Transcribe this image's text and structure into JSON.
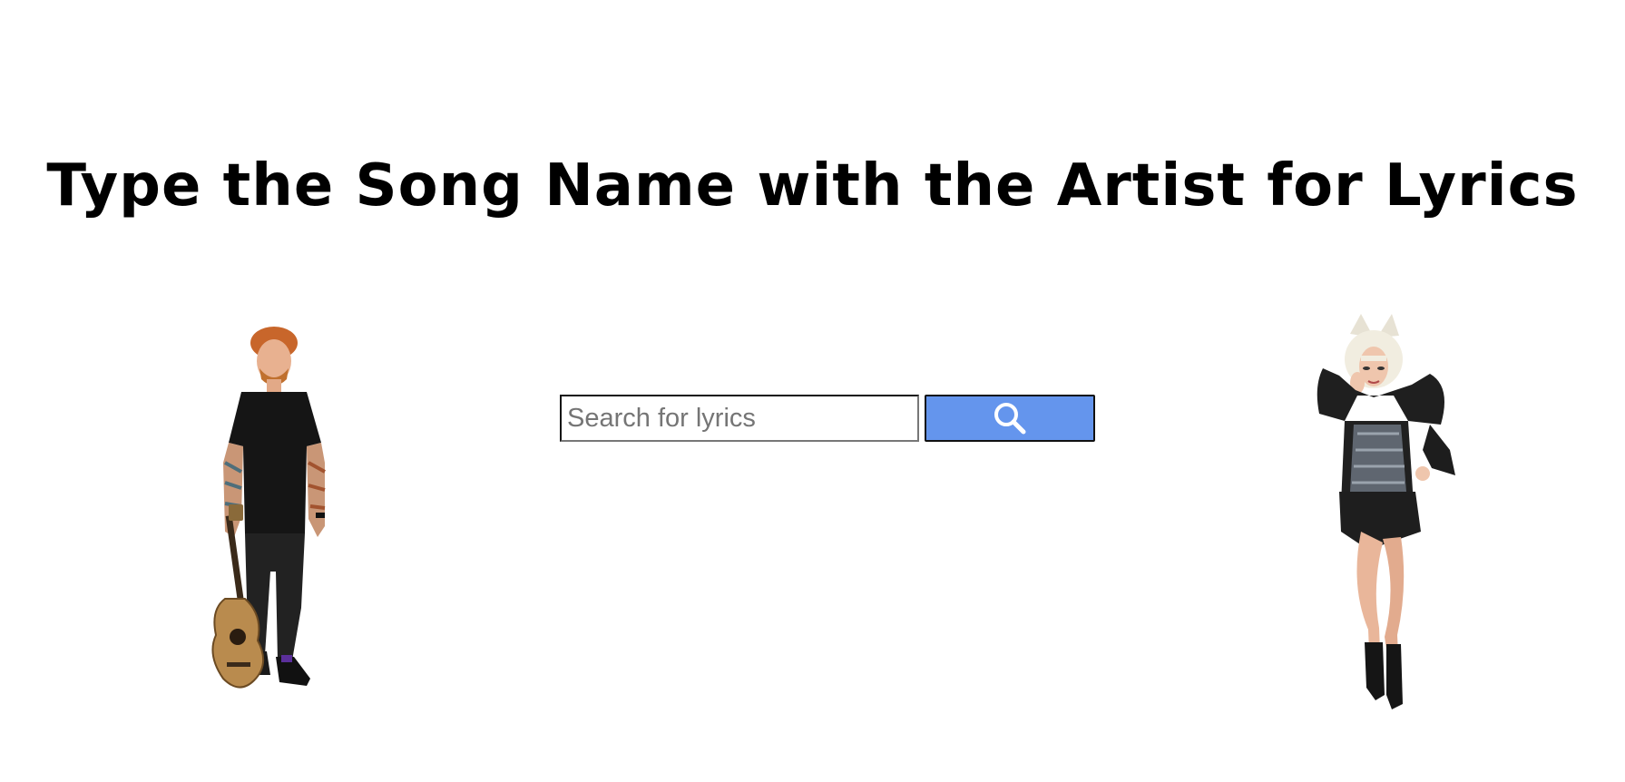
{
  "page": {
    "title": "Type the Song Name with the Artist for Lyrics"
  },
  "search": {
    "placeholder": "Search for lyrics",
    "value": "",
    "button_icon": "search-icon",
    "button_color": "#6495ed"
  },
  "images": {
    "left": "artist-photo-guitar",
    "right": "artist-photo-costume"
  }
}
